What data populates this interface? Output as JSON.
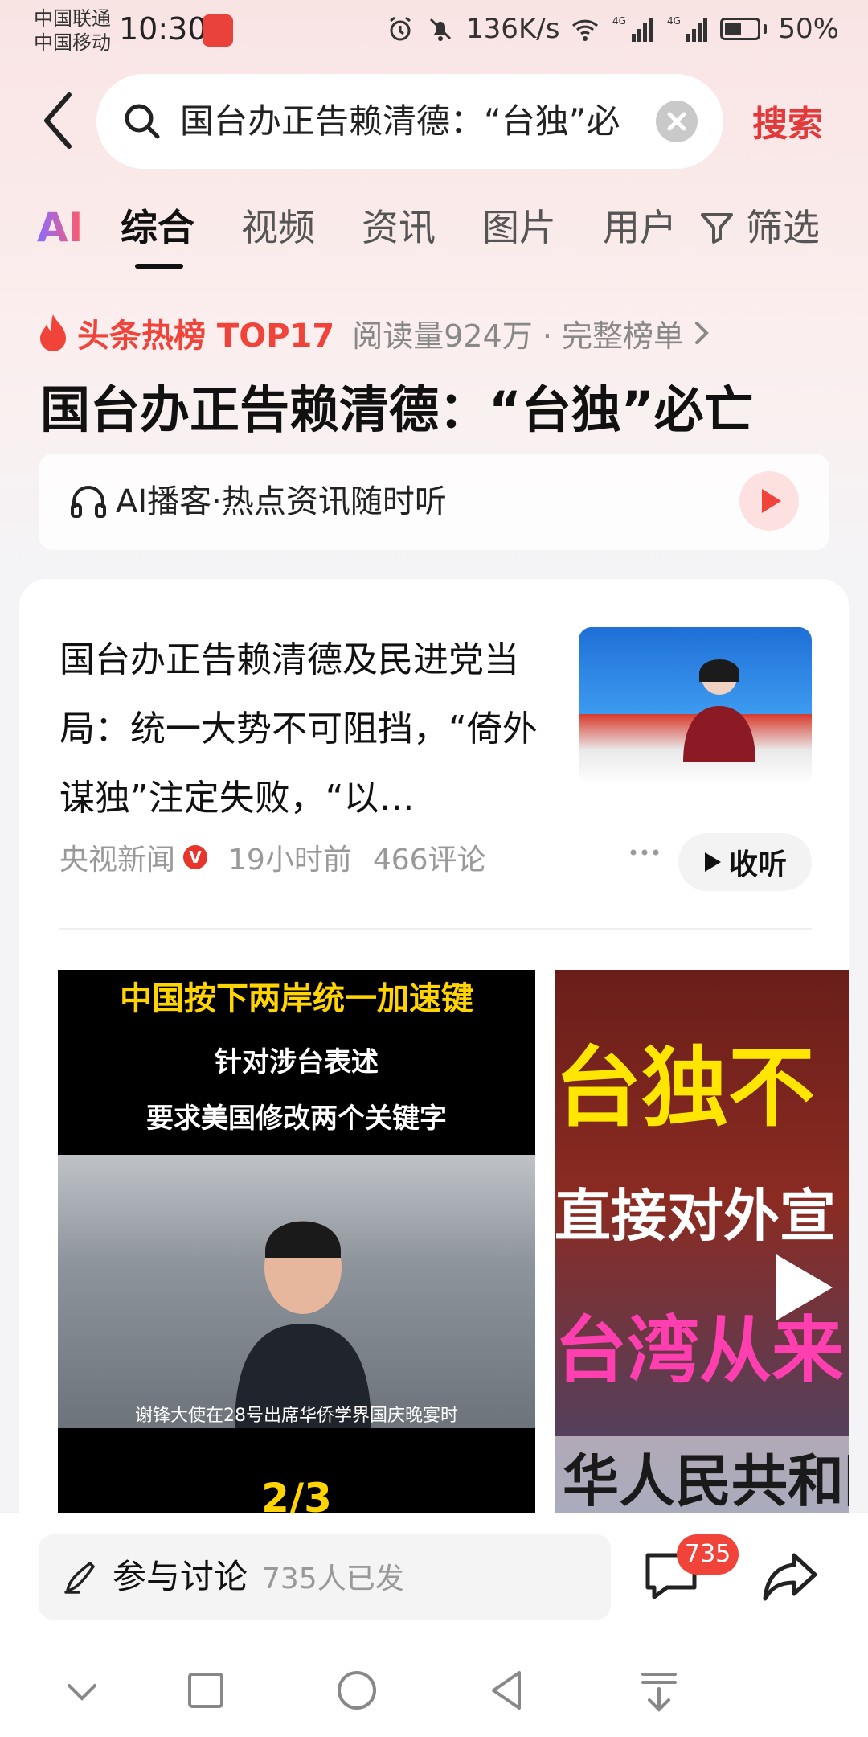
{
  "status_bar": {
    "carrier_1": "中国联通",
    "carrier_2": "中国移动",
    "time": "10:30",
    "speed": "136K/s",
    "network_1": "4G",
    "network_2": "4G",
    "battery": "50%"
  },
  "search": {
    "query": "国台办正告赖清德：“台独”必",
    "button_label": "搜索"
  },
  "tabs": {
    "ai": "AI",
    "items": [
      "综合",
      "视频",
      "资讯",
      "图片",
      "用户"
    ],
    "filter": "筛选"
  },
  "hot": {
    "label": "头条热榜 TOP17",
    "meta": "阅读量924万 · 完整榜单",
    "title": "国台办正告赖清德：“台独”必亡"
  },
  "ai_podcast": {
    "label": "AI播客·热点资讯随时听"
  },
  "article": {
    "title": "国台办正告赖清德及民进党当局：统一大势不可阻挡，“倚外谋独”注定失败，“以…",
    "source": "央视新闻",
    "verified_mark": "V",
    "time": "19小时前",
    "comments": "466评论",
    "listen_label": "收听"
  },
  "video_1": {
    "caption_1": "中国按下两岸统一加速键",
    "caption_2": "针对涉台表述",
    "caption_3": "要求美国修改两个关键字",
    "subtitle": "谢锋大使在28号出席华侨学界国庆晚宴时",
    "page": "2/3"
  },
  "video_2": {
    "line_1": "台独不",
    "line_2": "直接对外宣",
    "line_3": "台湾从来",
    "line_4": "华人民共和国"
  },
  "bottom_bar": {
    "discuss_label": "参与讨论",
    "discuss_count": "735人已发",
    "comment_badge": "735"
  },
  "colors": {
    "accent": "#e23a3a",
    "badge": "#f0443a",
    "hot": "#f0433a"
  }
}
